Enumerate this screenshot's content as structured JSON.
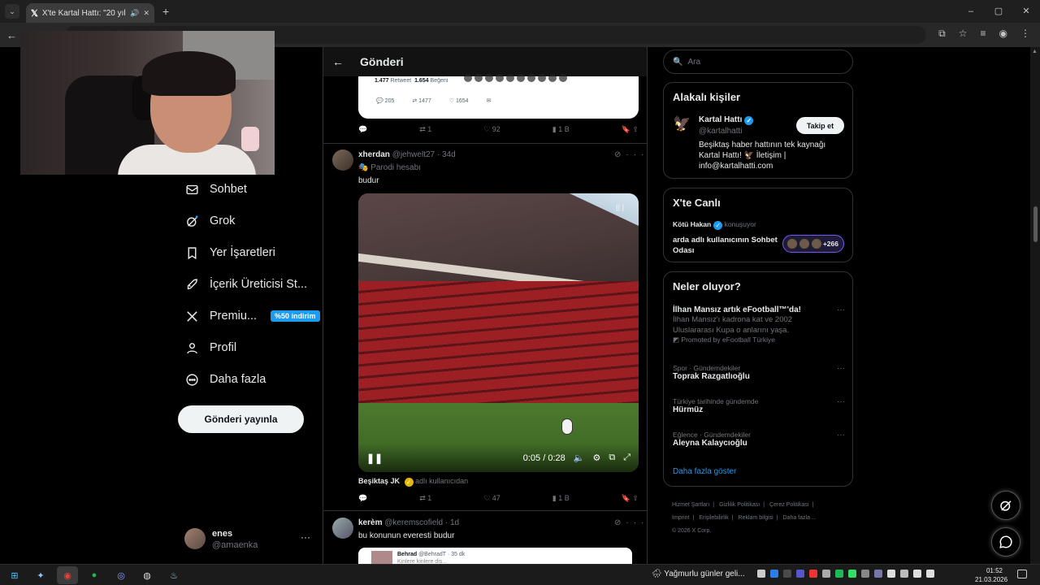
{
  "browser": {
    "tab_title": "X'te Kartal Hattı: \"20 yıl önc",
    "new_tab": "+",
    "window_controls": [
      "–",
      "▢",
      "✕"
    ]
  },
  "nav": {
    "items": [
      {
        "label": "Sohbet",
        "icon": "mail-icon"
      },
      {
        "label": "Grok",
        "icon": "grok-icon"
      },
      {
        "label": "Yer İşaretleri",
        "icon": "bookmark-icon"
      },
      {
        "label": "İçerik Üreticisi St...",
        "icon": "rocket-icon"
      },
      {
        "label": "Premiu...",
        "icon": "x-icon",
        "badge": "%50 indirim"
      },
      {
        "label": "Profil",
        "icon": "person-icon"
      },
      {
        "label": "Daha fazla",
        "icon": "more-circle-icon"
      }
    ],
    "post_button": "Gönderi yayınla",
    "account": {
      "name": "enes",
      "handle": "@amaenka",
      "more": "···"
    }
  },
  "feed": {
    "header_title": "Gönderi",
    "back": "←",
    "quote_card": {
      "retweets_value": "1.477",
      "retweets_label": "Retweet",
      "likes_value": "1.654",
      "likes_label": "Beğeni",
      "replies": "205",
      "reposts": "1477",
      "likes": "1654"
    },
    "top_actions": {
      "reply": "",
      "repost": "1",
      "like": "92",
      "views": "1 B"
    },
    "tweet1": {
      "name": "xherdan",
      "handle": "@jehwelt27",
      "time": "· 34d",
      "parody": "Parodi hesabı",
      "text": "budur",
      "video_time": "0:05 / 0:28",
      "via_name": "Beşiktaş JK",
      "via_suffix": "adlı kullanıcıdan",
      "actions": {
        "reply": "",
        "repost": "1",
        "like": "47",
        "views": "1 B"
      }
    },
    "tweet2": {
      "name": "kerèm",
      "handle": "@keremscofield",
      "time": "· 1d",
      "text": "bu konunun everesti budur",
      "quote_name": "Behrad",
      "quote_handle": "@BehradT · 35 dk",
      "quote_text": "Kinlere kinlere dis..."
    }
  },
  "right": {
    "search_placeholder": "Ara",
    "who": {
      "title": "Alakalı kişiler",
      "name": "Kartal Hattı",
      "handle": "@kartalhatti",
      "follow": "Takip et",
      "bio": "Beşiktaş haber hattının tek kaynağı Kartal Hattı! 🦅 İletişim | info@kartalhatti.com"
    },
    "live": {
      "title": "X'te Canlı",
      "host": "Kötü Hakan",
      "status": "konuşuyor",
      "room": "arda adlı kullanıcının Sohbet Odası",
      "count": "+266"
    },
    "trends": {
      "title": "Neler oluyor?",
      "items": [
        {
          "category": "",
          "title": "İlhan Mansız artık eFootball™'da!",
          "desc": "İlhan Mansız'ı kadrona kat ve 2002 Uluslararası Kupa o anlarını yaşa.",
          "promo": "Promoted by eFootball Türkiye"
        },
        {
          "category": "Spor · Gündemdekiler",
          "title": "Toprak Razgatlıoğlu"
        },
        {
          "category": "Türkiye tarihinde gündemde",
          "title": "Hürmüz"
        },
        {
          "category": "Eğlence · Gündemdekiler",
          "title": "Aleyna Kalaycıoğlu"
        }
      ],
      "show_more": "Daha fazla göster"
    },
    "footer": [
      "Hizmet Şartları",
      "|",
      "Gizlilik Politikası",
      "|",
      "Çerez Politikası",
      "|",
      "Imprint",
      "|",
      "Erişilebilirlik",
      "|",
      "Reklam bilgisi",
      "|",
      "Daha fazla ...",
      "© 2026 X Corp."
    ]
  },
  "taskbar": {
    "weather": "Yağmurlu günler geli...",
    "time": "01:52",
    "date": "21.03.2026"
  },
  "colors": {
    "accent": "#1d9bf0",
    "background": "#000000",
    "border": "#2f3336",
    "muted": "#71767b"
  }
}
